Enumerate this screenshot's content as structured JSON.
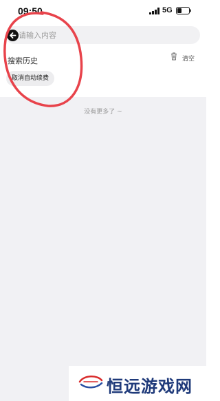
{
  "status_bar": {
    "time": "09:50",
    "network": "5G",
    "signal_icon": "signal-bars-icon",
    "battery_icon": "battery-icon"
  },
  "search": {
    "placeholder": "请输入内容",
    "back_icon": "back-arrow-icon"
  },
  "history": {
    "title": "搜索历史",
    "clear_label": "清空",
    "clear_icon": "trash-icon",
    "items": [
      {
        "label": "取消自动续费"
      }
    ]
  },
  "results": {
    "no_more_text": "没有更多了 ~"
  },
  "watermark": {
    "text": "恒远游戏网"
  },
  "colors": {
    "background": "#ffffff",
    "content_gray": "#f1f1f4",
    "annotation": "#e8434b",
    "watermark_text": "#1f3a7a"
  }
}
